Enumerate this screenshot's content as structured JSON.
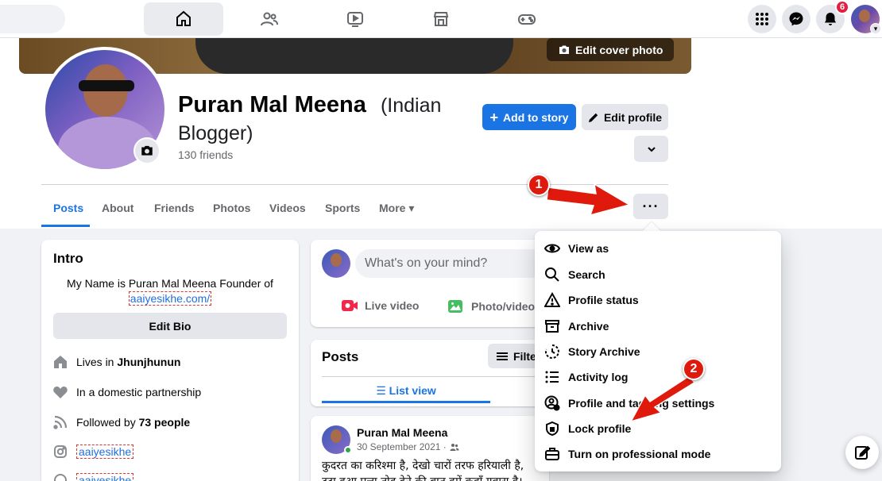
{
  "topbar": {
    "notifications_count": "6",
    "icons": [
      "home-icon",
      "friends-icon",
      "watch-icon",
      "marketplace-icon",
      "gaming-icon",
      "menu-grid-icon",
      "messenger-icon",
      "bell-icon"
    ]
  },
  "cover": {
    "edit_label": "Edit cover photo"
  },
  "profile": {
    "name": "Puran Mal Meena",
    "subtitle": "(Indian",
    "subtitle2": "Blogger)",
    "friends": "130 friends"
  },
  "actions": {
    "add_story": "Add to story",
    "edit_profile": "Edit profile",
    "more_dots": "···"
  },
  "tabs": [
    "Posts",
    "About",
    "Friends",
    "Photos",
    "Videos",
    "Sports",
    "More ▾"
  ],
  "intro": {
    "title": "Intro",
    "bio_line1": "My Name is Puran Mal Meena Founder of",
    "bio_link": "aaiyesikhe.com/",
    "edit_bio": "Edit Bio",
    "lives_prefix": "Lives in ",
    "lives_city": "Jhunjhunun",
    "relationship": "In a domestic partnership",
    "followed_prefix": "Followed by ",
    "followed_count": "73 people",
    "instagram": "aaiyesikhe",
    "other_link": "aaiyesikhe"
  },
  "composer": {
    "placeholder": "What's on your mind?",
    "live_video": "Live video",
    "photo_video": "Photo/video"
  },
  "posts_card": {
    "title": "Posts",
    "filter": "Filter",
    "list_view": "List view"
  },
  "post": {
    "author": "Puran Mal Meena",
    "date": "30 September 2021 ·",
    "line1": "कुदरत का करिश्मा है, देखो चारों तरफ हरियाली है,",
    "line2": "टूटा हुआ पत्ता तोड़ देने की बात हमें कहाँ गवारा है।"
  },
  "menu": {
    "items": [
      {
        "label": "View as",
        "icon": "eye-icon"
      },
      {
        "label": "Search",
        "icon": "search-icon"
      },
      {
        "label": "Profile status",
        "icon": "warning-icon"
      },
      {
        "label": "Archive",
        "icon": "archive-icon"
      },
      {
        "label": "Story Archive",
        "icon": "story-archive-icon"
      },
      {
        "label": "Activity log",
        "icon": "list-icon"
      },
      {
        "label": "Profile and tagging settings",
        "icon": "profile-settings-icon"
      },
      {
        "label": "Lock profile",
        "icon": "shield-icon"
      },
      {
        "label": "Turn on professional mode",
        "icon": "briefcase-icon"
      }
    ]
  },
  "annotations": {
    "marker1": "1",
    "marker2": "2"
  },
  "colors": {
    "accent": "#1b74e4",
    "marker": "#e0190d",
    "badge": "#e41e3f"
  }
}
